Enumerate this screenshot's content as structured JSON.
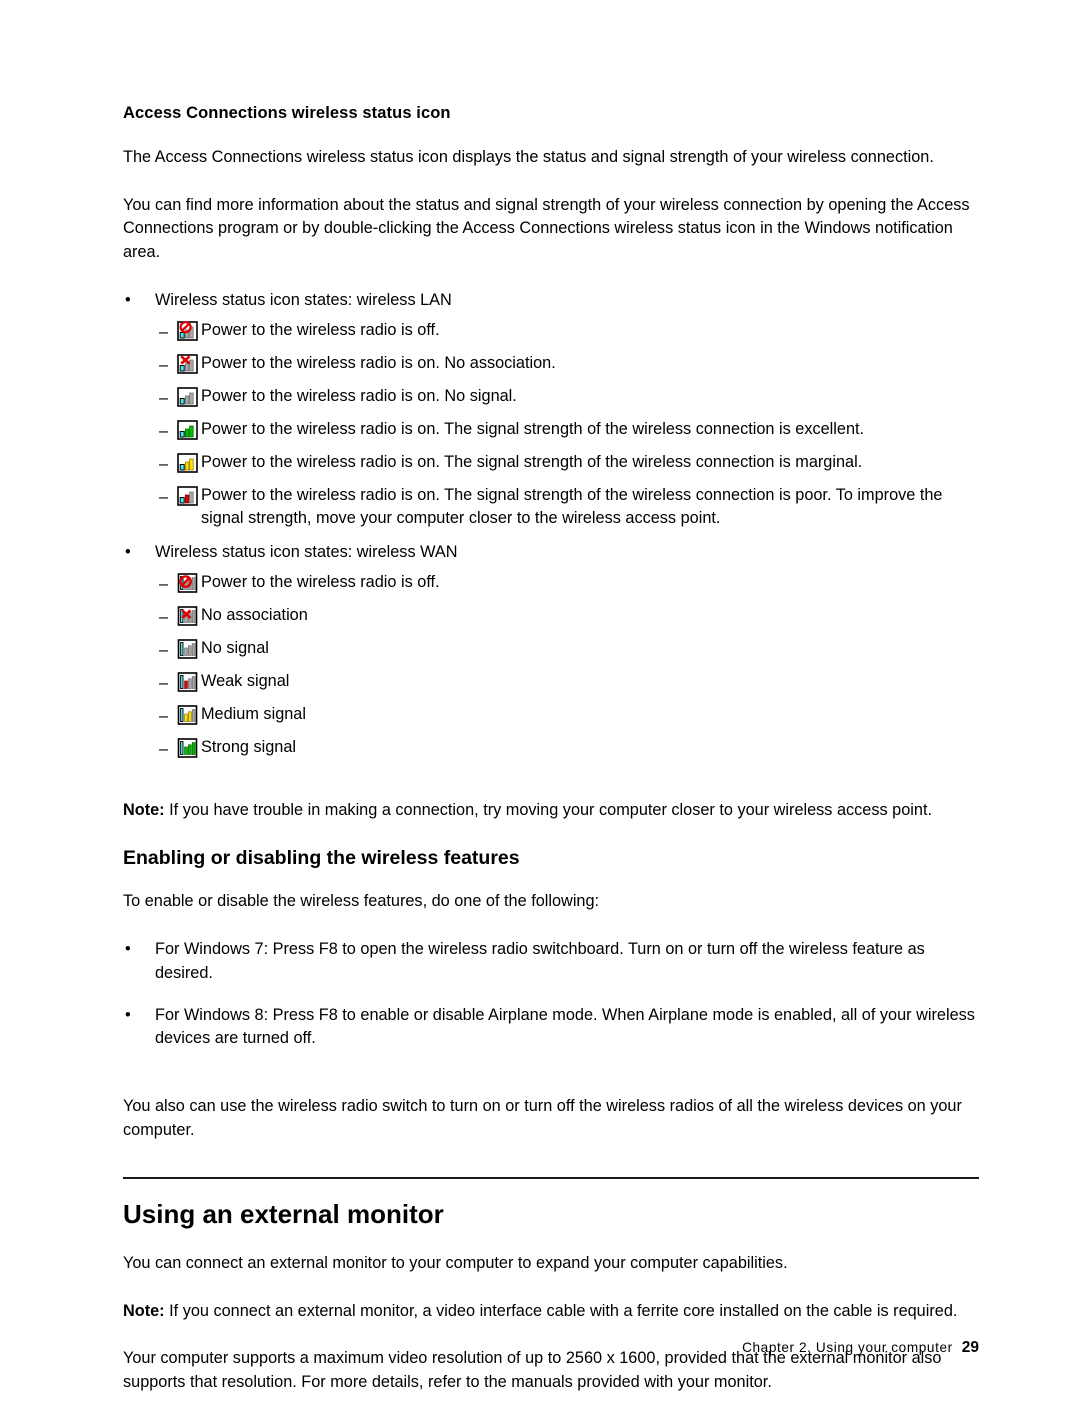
{
  "document": {
    "subheading": "Access Connections wireless status icon",
    "intro_paragraph": "The Access Connections wireless status icon displays the status and signal strength of your wireless connection.",
    "info_paragraph": "You can find more information about the status and signal strength of your wireless connection by opening the Access Connections program or by double-clicking the Access Connections wireless status icon in the Windows notification area.",
    "lan": {
      "bullet_label": "Wireless status icon states:  wireless LAN",
      "items": [
        {
          "icon": "wlan-radio-off-icon",
          "text": "Power to the wireless radio is off."
        },
        {
          "icon": "wlan-no-association-icon",
          "text": "Power to the wireless radio is on.  No association."
        },
        {
          "icon": "wlan-no-signal-icon",
          "text": "Power to the wireless radio is on.  No signal."
        },
        {
          "icon": "wlan-signal-excellent-icon",
          "text": "Power to the wireless radio is on.  The signal strength of the wireless connection is excellent."
        },
        {
          "icon": "wlan-signal-marginal-icon",
          "text": "Power to the wireless radio is on.  The signal strength of the wireless connection is marginal."
        },
        {
          "icon": "wlan-signal-poor-icon",
          "text": "Power to the wireless radio is on.  The signal strength of the wireless connection is poor. To improve the signal strength, move your computer closer to the wireless access point."
        }
      ]
    },
    "wan": {
      "bullet_label": "Wireless status icon states:  wireless WAN",
      "items": [
        {
          "icon": "wwan-radio-off-icon",
          "text": "Power to the wireless radio is off."
        },
        {
          "icon": "wwan-no-association-icon",
          "text": "No association"
        },
        {
          "icon": "wwan-no-signal-icon",
          "text": "No signal"
        },
        {
          "icon": "wwan-weak-signal-icon",
          "text": "Weak signal"
        },
        {
          "icon": "wwan-medium-signal-icon",
          "text": "Medium signal"
        },
        {
          "icon": "wwan-strong-signal-icon",
          "text": "Strong signal"
        }
      ]
    },
    "note_wireless": {
      "label": "Note:",
      "text": " If you have trouble in making a connection, try moving your computer closer to your wireless access point."
    },
    "enabling_section": {
      "heading": "Enabling or disabling the wireless features",
      "lead": "To enable or disable the wireless features, do one of the following:",
      "bullets": [
        "For Windows 7: Press F8 to open the wireless radio switchboard.  Turn on or turn off the wireless feature as desired.",
        "For Windows 8: Press F8 to enable or disable Airplane mode.  When Airplane mode is enabled, all of your wireless devices are turned off."
      ],
      "closing": "You also can use the wireless radio switch to turn on or turn off the wireless radios of all the wireless devices on your computer."
    },
    "monitor_section": {
      "heading": "Using an external monitor",
      "intro": "You can connect an external monitor to your computer to expand your computer capabilities.",
      "note": {
        "label": "Note:",
        "text": " If you connect an external monitor, a video interface cable with a ferrite core installed on the cable is required."
      },
      "resolution_paragraph": "Your computer supports a maximum video resolution of up to 2560 x 1600, provided that the external monitor also supports that resolution. For more details, refer to the manuals provided with your monitor."
    },
    "footer": {
      "chapter_text": "Chapter 2.  Using your computer",
      "page_number": "29"
    },
    "glyphs": {
      "bullet": "•",
      "dash": "–"
    },
    "colors": {
      "text": "#000000",
      "rule": "#1a1a1a",
      "signal_green": "#00c000",
      "signal_yellow": "#ffe000",
      "signal_red": "#e00000",
      "signal_gray": "#a8a8a8",
      "icon_cyan": "#49e8f0",
      "icon_frame": "#000000",
      "icon_bg": "#ffffff",
      "overlay_red": "#e00000"
    }
  }
}
